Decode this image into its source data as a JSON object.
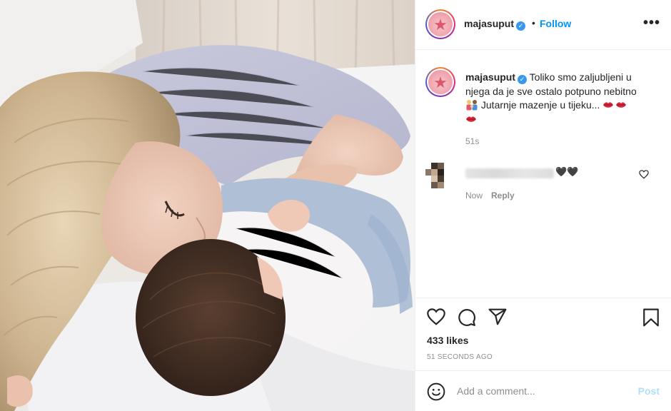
{
  "post": {
    "username": "majasuput",
    "verified_icon": "verified-badge-icon",
    "dot": "•",
    "follow_label": "Follow",
    "more_label": "•••"
  },
  "caption": {
    "username": "majasuput",
    "part1": " Toliko smo zaljubljeni u njega da je sve ostalo potpuno nebitno ",
    "part2": " Jutarnje mazenje u tijeku...",
    "time": "51s"
  },
  "comment": {
    "hearts": "🖤🖤",
    "time": "Now",
    "reply_label": "Reply"
  },
  "actions": {
    "likes": "433 likes",
    "ago": "51 SECONDS AGO"
  },
  "add_comment": {
    "placeholder": "Add a comment...",
    "post_label": "Post"
  },
  "colors": {
    "link_blue": "#0095f6",
    "post_disabled": "#b2dffc",
    "secondary_text": "#8e8e8e"
  }
}
